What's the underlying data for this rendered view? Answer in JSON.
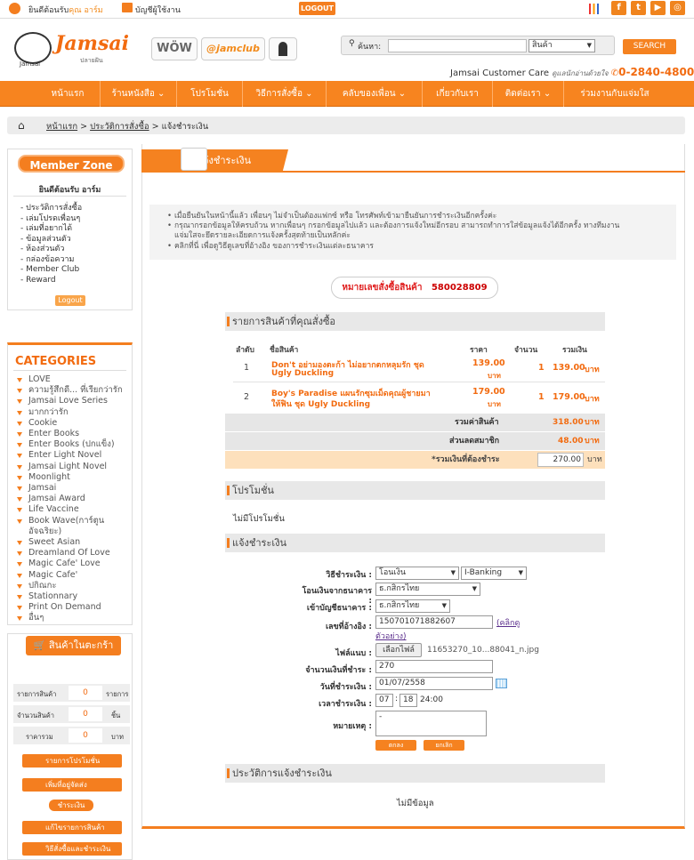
{
  "topbar": {
    "greeting": "ยินดีต้อนรับ",
    "user": "คุณ อาร์ม",
    "account": "บัญชีผู้ใช้งาน",
    "logout": "LOGOUT"
  },
  "social": [
    {
      "icon": "facebook-icon",
      "glyph": "f"
    },
    {
      "icon": "twitter-icon",
      "glyph": "t"
    },
    {
      "icon": "youtube-icon",
      "glyph": "▶"
    },
    {
      "icon": "instagram-icon",
      "glyph": "◎"
    }
  ],
  "header": {
    "logo_word": "Jamsai",
    "logo_sub": "Jamsai",
    "logo_thai": "ปลายฝัน",
    "wow": "WÖW",
    "jamclub": "@jamclub",
    "search_label": "ค้นหา:",
    "search_value": "",
    "search_type": "สินค้า",
    "search_button": "SEARCH",
    "care": "Jamsai Customer Care",
    "care_sub": "ดูแลนักอ่านด้วยใจ",
    "phone": "0-2840-4800"
  },
  "nav": [
    "หน้าแรก",
    "ร้านหนังสือ ⌄",
    "โปรโมชั่น",
    "วิธีการสั่งซื้อ ⌄",
    "คลับของเพื่อน ⌄",
    "เกี่ยวกับเรา",
    "ติดต่อเรา ⌄",
    "ร่วมงานกับแจ่มใส"
  ],
  "breadcrumb": {
    "home": "หน้าแรก",
    "sep1": " > ",
    "history": "ประวัติการสั่งซื้อ",
    "sep2": " > ",
    "current": "แจ้งชำระเงิน"
  },
  "member": {
    "title": "Member Zone",
    "welcome": "ยินดีต้อนรับ อาร์ม",
    "links": [
      "ประวัติการสั่งซื้อ",
      "เล่มโปรดเพื่อนๆ",
      "เล่มที่อยากได้",
      "ข้อมูลส่วนตัว",
      "ห้องส่วนตัว",
      "กล่องข้อความ",
      "Member Club",
      "Reward"
    ],
    "logout": "Logout"
  },
  "categories": {
    "title": "CATEGORIES",
    "items": [
      "LOVE",
      "ความรู้สึกดี... ที่เรียกว่ารัก",
      "Jamsai Love Series",
      "มากกว่ารัก",
      "Cookie",
      "Enter Books",
      "Enter Books (ปกแข็ง)",
      "Enter Light Novel",
      "Jamsai Light Novel",
      "Moonlight",
      "Jamsai",
      "Jamsai Award",
      "Life Vaccine",
      "Book Wave(การ์ตูน",
      "อัจฉริยะ)",
      "Sweet Asian",
      "Dreamland Of Love",
      "Magic Cafe' Love",
      "Magic Cafe'",
      "ปกิณกะ",
      "Stationnary",
      "Print On Demand",
      "อื่นๆ"
    ]
  },
  "cart": {
    "title": "สินค้าในตะกร้า",
    "rows": [
      {
        "label": "รายการสินค้า",
        "value": "0",
        "unit": "รายการ"
      },
      {
        "label": "จำนวนสินค้า",
        "value": "0",
        "unit": "ชิ้น"
      },
      {
        "label": "ราคารวม",
        "value": "0",
        "unit": "บาท"
      }
    ],
    "btn_promo": "รายการโปรโมชั่น",
    "btn_address": "เพิ่มที่อยู่จัดส่ง",
    "btn_pay": "ชำระเงิน",
    "btn_edit": "แก้ไขรายการสินค้า",
    "btn_how": "วิธีสั่งซื้อและชำระเงิน"
  },
  "page": {
    "title": "แจ้งชำระเงิน",
    "info": [
      "เมื่อยืนยันในหน้านี้แล้ว เพื่อนๆ ไม่จำเป็นต้องแฟกซ์ หรือ โทรศัพท์เข้ามายืนยันการชำระเงินอีกครั้งค่ะ",
      "กรุณากรอกข้อมูลให้ครบถ้วน หากเพื่อนๆ กรอกข้อมูลไปแล้ว และต้องการแจ้งใหม่อีกรอบ สามารถทำการใส่ข้อมูลแจ้งได้อีกครั้ง ทางทีมงาน",
      "แจ่มใสจะยึดรายละเอียดการแจ้งครั้งสุดท้ายเป็นหลักค่ะ",
      "คลิกที่นี่ เพื่อดูวิธีดูเลขที่อ้างอิง ของการชำระเงินแต่ละธนาคาร"
    ],
    "order_label": "หมายเลขสั่งซื้อสินค้า",
    "order_no": "580028809",
    "items_title": "รายการสินค้าที่คุณสั่งซื้อ",
    "headers": {
      "no": "ลำดับ",
      "name": "ชื่อสินค้า",
      "price": "ราคา",
      "qty": "จำนวน",
      "sum": "รวมเงิน"
    },
    "items": [
      {
        "no": "1",
        "name1": "Don't อย่ามองตะก้า ไม่อยากตกหลุมรัก ชุด",
        "name2": "Ugly Duckling",
        "price": "139.00",
        "baht": "บาท",
        "qty": "1",
        "sum": "139.00",
        "unit": "บาท"
      },
      {
        "no": "2",
        "name1": "Boy's Paradise แผนรักซุมเม็ดคุณผู้ชายมา",
        "name2": "ให้ฟิน ชุด Ugly Duckling",
        "price": "179.00",
        "baht": "บาท",
        "qty": "1",
        "sum": "179.00",
        "unit": "บาท"
      }
    ],
    "subtotal_label": "รวมค่าสินค้า",
    "subtotal": "318.00",
    "discount_label": "ส่วนลดสมาชิก",
    "discount": "48.00",
    "total_label": "*รวมเงินที่ต้องชำระ",
    "total": "270.00",
    "baht": "บาท",
    "promo_title": "โปรโมชั่น",
    "promo_text": "ไม่มีโปรโมชั่น",
    "pay_title": "แจ้งชำระเงิน",
    "form": {
      "method_label": "วิธีชำระเงิน :",
      "method": "โอนเงิน",
      "method2": "I-Banking",
      "from_label": "โอนเงินจากธนาคาร :",
      "from": "ธ.กสิกรไทย",
      "to_label": "เข้าบัญชีธนาคาร :",
      "to": "ธ.กสิกรไทย",
      "ref_label": "เลขที่อ้างอิง :",
      "ref": "150701071882607",
      "ref_link1": "(คลิกดู",
      "ref_link2": "ตัวอย่าง)",
      "file_label": "ไฟล์แนบ :",
      "file_btn": "เลือกไฟล์",
      "file_name": "11653270_10...88041_n.jpg",
      "amount_label": "จำนวนเงินที่ชำระ :",
      "amount": "270",
      "date_label": "วันที่ชำระเงิน :",
      "date": "01/07/2558",
      "time_label": "เวลาชำระเงิน :",
      "hh": "07",
      "mm": "18",
      "ss": "24:00",
      "note_label": "หมายเหตุ :",
      "note": "-",
      "ok": "ตกลง",
      "cancel": "ยกเลิก"
    },
    "history_title": "ประวัติการแจ้งชำระเงิน",
    "history_text": "ไม่มีข้อมูล"
  }
}
